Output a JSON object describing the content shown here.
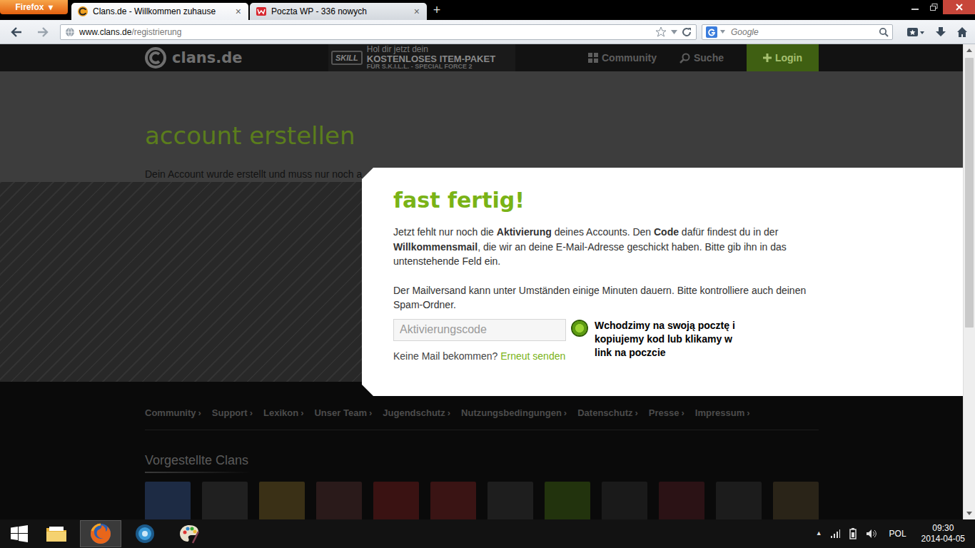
{
  "browser": {
    "menu_button": "Firefox",
    "menu_arrow": "▾",
    "tabs": [
      {
        "label": "Clans.de - Willkommen zuhause",
        "selected": true,
        "close": "×",
        "kind": "clans"
      },
      {
        "label": "Poczta WP - 336 nowych",
        "selected": false,
        "close": "×",
        "kind": "wp"
      }
    ],
    "new_tab": "+",
    "address_host": "www.clans.de",
    "address_path": "/registrierung",
    "search": {
      "placeholder": "Google"
    }
  },
  "page": {
    "logo": "clans.de",
    "ad": {
      "brand": "SKILL",
      "line1": "Hol dir jetzt dein",
      "line2": "KOSTENLOSES ITEM-PAKET",
      "line3": "FÜR S.K.I.L.L. - SPECIAL FORCE 2"
    },
    "nav": [
      {
        "label": "Community",
        "kind": "community"
      },
      {
        "label": "Suche",
        "kind": "search"
      }
    ],
    "login": "Login",
    "heading": "account erstellen",
    "intro": "Dein Account wurde erstellt und muss nur noch a",
    "footer_links": [
      "Community",
      "Support",
      "Lexikon",
      "Unser Team",
      "Jugendschutz",
      "Nutzungsbedingungen",
      "Datenschutz",
      "Presse",
      "Impressum"
    ],
    "footer_chevron": "›",
    "featured_title": "Vorgestellte Clans",
    "featured_clans": [
      {
        "color": "#1d2b44"
      },
      {
        "color": "#202020"
      },
      {
        "color": "#3a3016"
      },
      {
        "color": "#2a1a1a"
      },
      {
        "color": "#3a1212"
      },
      {
        "color": "#3a1414"
      },
      {
        "color": "#1e1e1e"
      },
      {
        "color": "#22330d"
      },
      {
        "color": "#1a1a1a"
      },
      {
        "color": "#2b1215"
      },
      {
        "color": "#1c1c1c"
      },
      {
        "color": "#2a2418"
      }
    ]
  },
  "modal": {
    "title": "fast fertig!",
    "paragraph1": [
      {
        "text": "Jetzt fehlt nur noch die ",
        "bold": false
      },
      {
        "text": "Aktivierung",
        "bold": true
      },
      {
        "text": " deines Accounts. Den ",
        "bold": false
      },
      {
        "text": "Code",
        "bold": true
      },
      {
        "text": " dafür findest du in der ",
        "bold": false
      },
      {
        "text": "Willkommensmail",
        "bold": true
      },
      {
        "text": ", die wir an deine E-Mail-Adresse geschickt haben. Bitte gib ihn in das untenstehende Feld ein.",
        "bold": false
      }
    ],
    "paragraph2": "Der Mailversand kann unter Umständen einige Minuten dauern. Bitte kontrolliere auch deinen Spam-Ordner.",
    "code_placeholder": "Aktivierungscode",
    "no_mail": "Keine Mail bekommen?",
    "resend": "Erneut senden"
  },
  "annotation": {
    "text": "Wchodzimy na swoją pocztę i kopiujemy kod lub klikamy w link na poczcie"
  },
  "taskbar": {
    "apps": [
      {
        "kind": "explorer",
        "selected": false
      },
      {
        "kind": "firefox",
        "selected": true
      },
      {
        "kind": "media",
        "selected": false
      },
      {
        "kind": "paint",
        "selected": false
      }
    ],
    "tray_arrow": "▲",
    "language": "POL",
    "time": "09:30",
    "date": "2014-04-05"
  }
}
